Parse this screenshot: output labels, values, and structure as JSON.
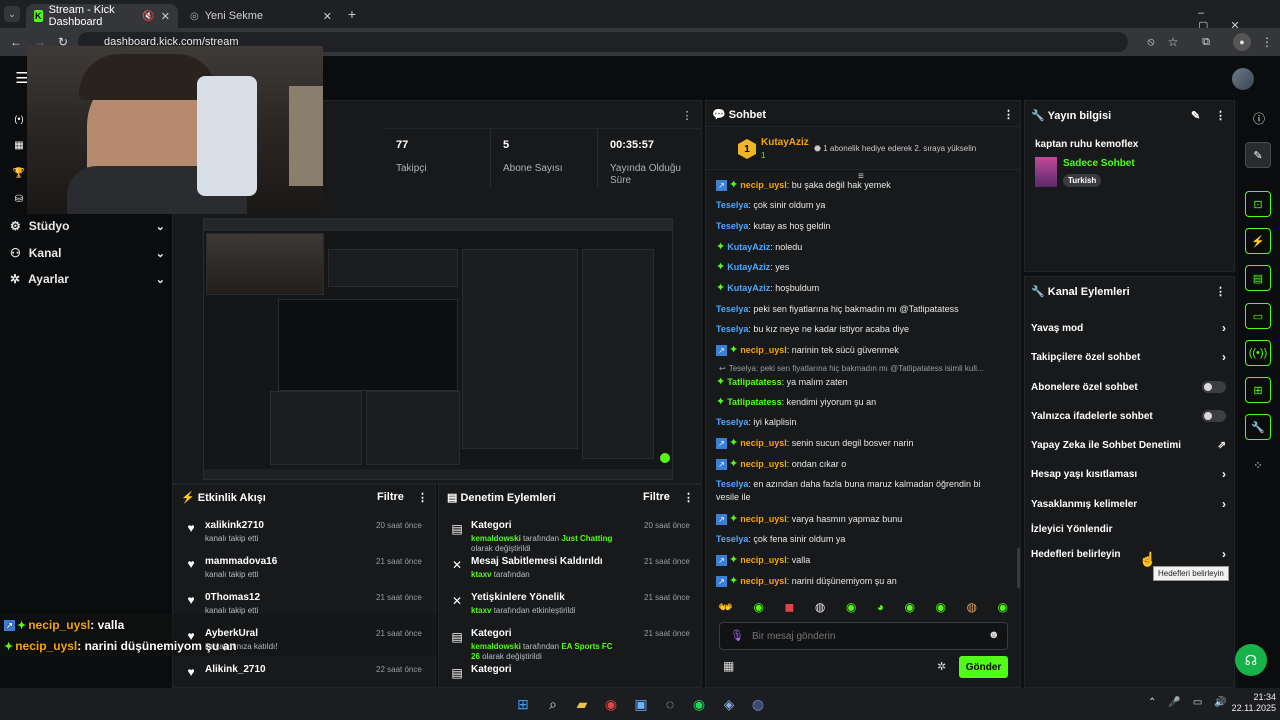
{
  "browser": {
    "tabs": [
      {
        "label": "Stream - Kick Dashboard",
        "active": true
      },
      {
        "label": "Yeni Sekme",
        "active": false
      }
    ],
    "url": "dashboard.kick.com/stream"
  },
  "sidebar": {
    "items": [
      {
        "label": "Stüdyo",
        "icon": "studio-icon"
      },
      {
        "label": "Kanal",
        "icon": "channel-icon"
      },
      {
        "label": "Ayarlar",
        "icon": "gear-icon"
      }
    ]
  },
  "stats": [
    {
      "value": "77",
      "label": "Takipçi"
    },
    {
      "value": "5",
      "label": "Abone Sayısı"
    },
    {
      "value": "00:35:57",
      "label": "Yayında Olduğu Süre"
    }
  ],
  "activity": {
    "title": "Etkinlik Akışı",
    "filter": "Filtre",
    "items": [
      {
        "name": "xalikink2710",
        "sub": "kanalı takip etti",
        "time": "20 saat önce"
      },
      {
        "name": "mammadova16",
        "sub": "kanalı takip etti",
        "time": "21 saat önce"
      },
      {
        "name": "0Thomas12",
        "sub": "kanalı takip etti",
        "time": "21 saat önce"
      },
      {
        "name": "AyberkUral",
        "sub": "ile yayınınıza katıldı!",
        "time": "21 saat önce"
      },
      {
        "name": "Alikink_2710",
        "sub": "",
        "time": "22 saat önce"
      }
    ]
  },
  "moderation": {
    "title": "Denetim Eylemleri",
    "filter": "Filtre",
    "items": [
      {
        "title": "Kategori",
        "actor": "kemaldowski",
        "mid": "tarafından",
        "target": "Just Chatting",
        "end": "olarak değiştirildi",
        "time": "20 saat önce"
      },
      {
        "title": "Mesaj Sabitlemesi Kaldırıldı",
        "actor": "ktaxv",
        "mid": "tarafından",
        "target": "",
        "end": "",
        "time": "21 saat önce"
      },
      {
        "title": "Yetişkinlere Yönelik",
        "actor": "ktaxv",
        "mid": "tarafından etkinleştirildi",
        "target": "",
        "end": "",
        "time": "21 saat önce"
      },
      {
        "title": "Kategori",
        "actor": "kemaldowski",
        "mid": "tarafından",
        "target": "EA Sports FC 26",
        "end": "olarak değiştirildi",
        "time": "21 saat önce"
      },
      {
        "title": "Kategori",
        "actor": "",
        "mid": "",
        "target": "",
        "end": "",
        "time": ""
      }
    ]
  },
  "chat": {
    "title": "Sohbet",
    "pinned_user": "KutayAziz",
    "pinned_rank": "1",
    "pinned_count": "1",
    "pinned_text": "1 abonelik hediye ederek 2. sıraya yükselin",
    "reply_text": "Teselya: peki sen fiyatlarına hiç bakmadın mı @Tatlipatatess isimli kull...",
    "messages": [
      {
        "user": "necip_uysl",
        "color": "o",
        "text": ": bu şaka değil hak yemek"
      },
      {
        "user": "Teselya",
        "color": "b",
        "text": ": çok sinir oldum ya"
      },
      {
        "user": "Teselya",
        "color": "b",
        "text": ": kutay as hoş geldin"
      },
      {
        "user": "KutayAziz",
        "color": "b",
        "text": ": noledu"
      },
      {
        "user": "KutayAziz",
        "color": "b",
        "text": ": yes"
      },
      {
        "user": "KutayAziz",
        "color": "b",
        "text": ": hoşbuldum"
      },
      {
        "user": "Teselya",
        "color": "b",
        "text": ": peki sen fiyatlarına hiç bakmadın mı @Tatlipatatess"
      },
      {
        "user": "Teselya",
        "color": "b",
        "text": ": bu kız neye ne kadar istiyor acaba diye"
      },
      {
        "user": "necip_uysl",
        "color": "o",
        "text": ": narinin tek sücü güvenmek"
      },
      {
        "user": "Tatlipatatess",
        "color": "g",
        "text": ": ya malım zaten"
      },
      {
        "user": "Tatlipatatess",
        "color": "g",
        "text": ": kendimi yiyorum şu an"
      },
      {
        "user": "Teselya",
        "color": "b",
        "text": ": iyi kalplisin"
      },
      {
        "user": "necip_uysl",
        "color": "o",
        "text": ": senin sucun degil bosver narin"
      },
      {
        "user": "necip_uysl",
        "color": "o",
        "text": ": ondan cıkar o"
      },
      {
        "user": "Teselya",
        "color": "b",
        "text": ": en azından daha fazla buna maruz kalmadan öğrendin bi vesile ile"
      },
      {
        "user": "necip_uysl",
        "color": "o",
        "text": ": varya hasmın yapmaz bunu"
      },
      {
        "user": "Teselya",
        "color": "b",
        "text": ": çok fena sinir oldum ya"
      },
      {
        "user": "necip_uysl",
        "color": "o",
        "text": ": valla"
      },
      {
        "user": "necip_uysl",
        "color": "o",
        "text": ": narini düşünemiyom şu an"
      }
    ],
    "input_placeholder": "Bir mesaj gönderin",
    "send_label": "Gönder"
  },
  "stream_info": {
    "title": "Yayın bilgisi",
    "stream_title": "kaptan ruhu kemoflex",
    "category": "Sadece Sohbet",
    "tag": "Turkish"
  },
  "channel_actions": {
    "title": "Kanal Eylemleri",
    "items": [
      {
        "label": "Yavaş mod",
        "control": "chevron"
      },
      {
        "label": "Takipçilere özel sohbet",
        "control": "chevron"
      },
      {
        "label": "Abonelere özel sohbet",
        "control": "toggle"
      },
      {
        "label": "Yalnızca ifadelerle sohbet",
        "control": "toggle"
      },
      {
        "label": "Yapay Zeka ile Sohbet Denetimi",
        "control": "external"
      },
      {
        "label": "Hesap yaşı kısıtlaması",
        "control": "chevron"
      },
      {
        "label": "Yasaklanmış kelimeler",
        "control": "chevron"
      },
      {
        "label": "İzleyici Yönlendir",
        "control": "none"
      },
      {
        "label": "Hedefleri belirleyin",
        "control": "chevron"
      }
    ],
    "tooltip": "Hedefleri belirleyin"
  },
  "overlay": [
    {
      "user": "necip_uysl",
      "text": ": valla"
    },
    {
      "user": "necip_uysl",
      "text": ": narini düşünemiyom şu an"
    }
  ],
  "taskbar": {
    "time": "21:34",
    "date": "22.11.2025"
  },
  "colors": {
    "accent": "#53fc18",
    "panel": "#18191b",
    "bg": "#0f1011"
  }
}
